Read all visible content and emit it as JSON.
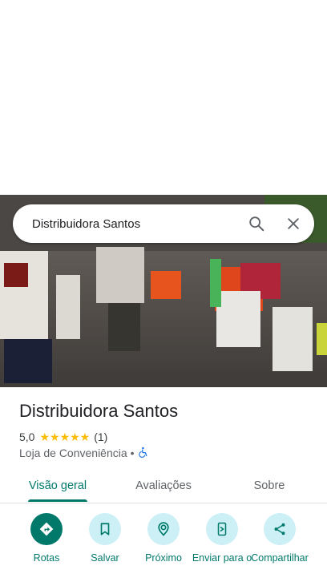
{
  "search": {
    "query": "Distribuidora Santos"
  },
  "place": {
    "name": "Distribuidora Santos",
    "rating": "5,0",
    "stars": "★★★★★",
    "reviews_count": "(1)",
    "category": "Loja de Conveniência",
    "separator": "•"
  },
  "tabs": [
    {
      "label": "Visão geral",
      "active": true
    },
    {
      "label": "Avaliações",
      "active": false
    },
    {
      "label": "Sobre",
      "active": false
    }
  ],
  "actions": [
    {
      "label": "Rotas",
      "icon": "directions-icon"
    },
    {
      "label": "Salvar",
      "icon": "bookmark-icon"
    },
    {
      "label": "Próximo",
      "icon": "nearby-icon"
    },
    {
      "label": "Enviar para o",
      "icon": "send-to-phone-icon"
    },
    {
      "label": "Compartilhar",
      "icon": "share-icon"
    }
  ],
  "colors": {
    "accent": "#00796b",
    "star": "#fbbc04",
    "action_bg": "#cdf0f6"
  }
}
